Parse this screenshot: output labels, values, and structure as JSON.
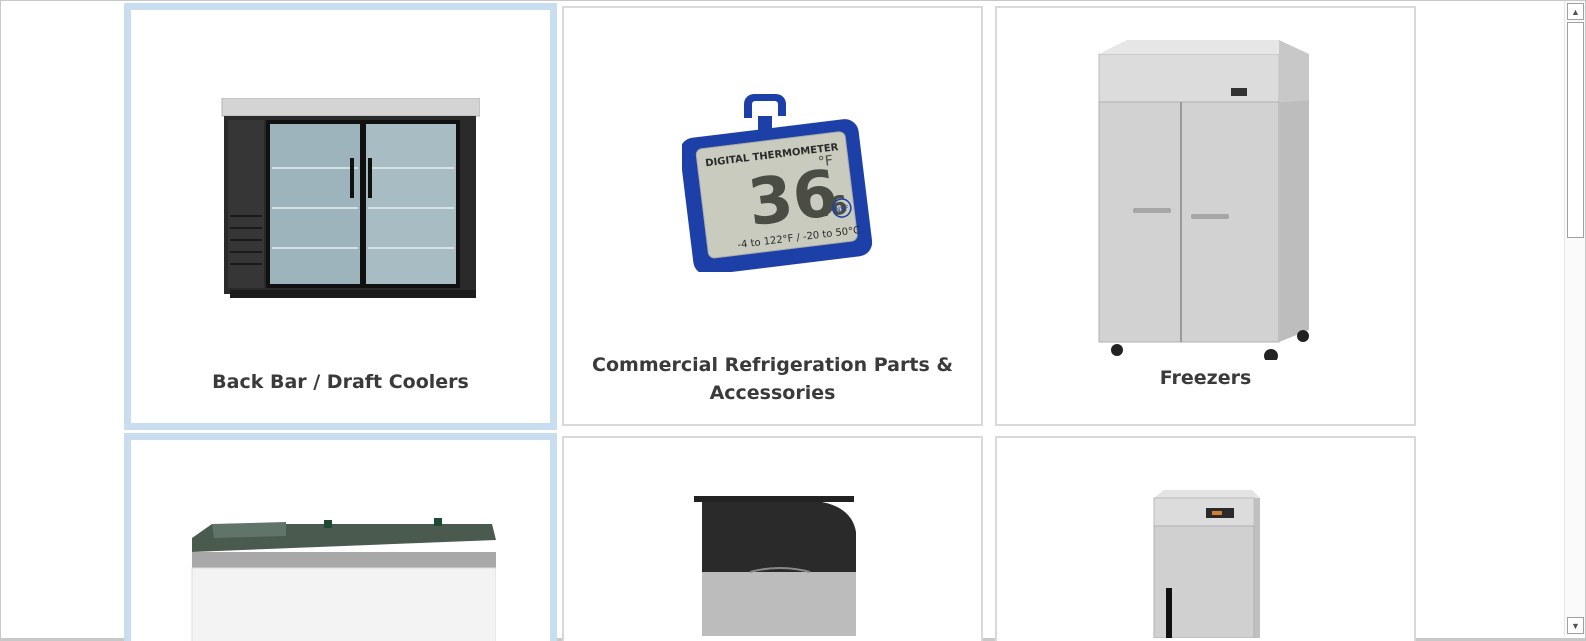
{
  "categories": [
    {
      "label": "Back Bar / Draft Coolers",
      "icon": "back-bar-cooler-image"
    },
    {
      "label": "Commercial Refrigeration Parts & Accessories",
      "icon": "digital-thermometer-image"
    },
    {
      "label": "Freezers",
      "icon": "reach-in-freezer-image"
    },
    {
      "label": "",
      "icon": "chest-freezer-image"
    },
    {
      "label": "",
      "icon": "ice-bin-image"
    },
    {
      "label": "",
      "icon": "reach-in-refrigerator-image"
    }
  ],
  "thermometer": {
    "brand_text": "DIGITAL THERMOMETER",
    "reading": "36",
    "reading_decimal": ".6",
    "unit": "°F",
    "range_text": "-4 to 122°F / -20 to 50°C",
    "badge": "NSF"
  },
  "colors": {
    "label": "#3a3a3a",
    "card_border": "#d9d9d9",
    "hover_border": "#c8def0",
    "thermo_blue": "#1c3fa8"
  }
}
